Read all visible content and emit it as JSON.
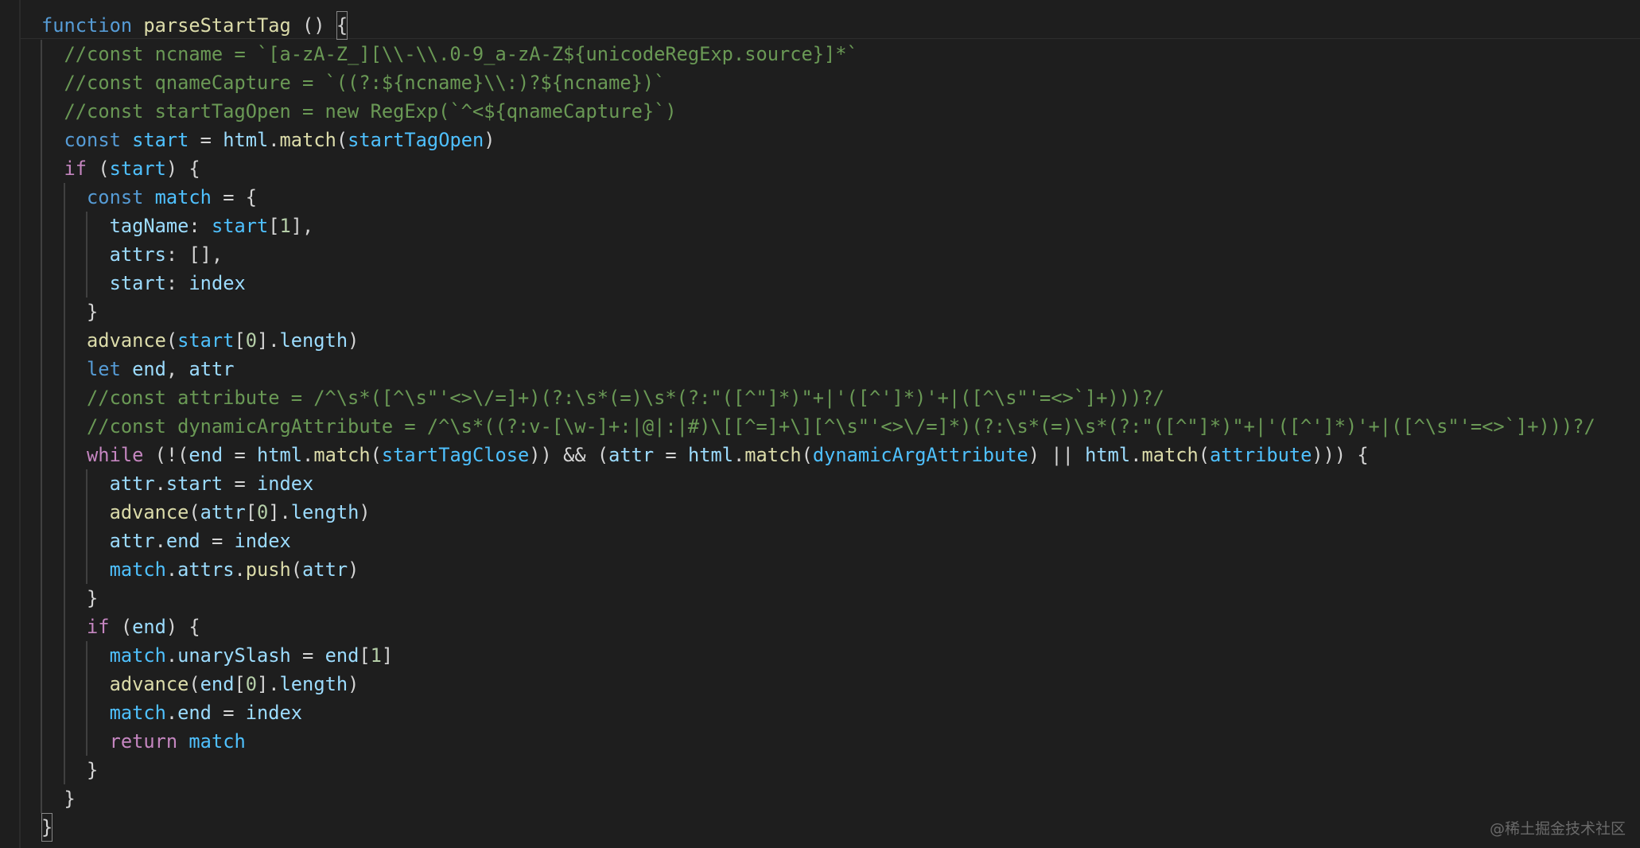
{
  "code": {
    "lines": [
      {
        "tokens": [
          {
            "c": "kw",
            "t": "function"
          },
          {
            "c": "pl",
            "t": " "
          },
          {
            "c": "fn",
            "t": "parseStartTag"
          },
          {
            "c": "pl",
            "t": " () "
          },
          {
            "c": "pl",
            "t": "{"
          }
        ]
      },
      {
        "tokens": [
          {
            "c": "pl",
            "t": "  "
          },
          {
            "c": "cm",
            "t": "//const ncname = `[a-zA-Z_][\\\\-\\\\.0-9_a-zA-Z${unicodeRegExp.source}]*`"
          }
        ]
      },
      {
        "tokens": [
          {
            "c": "pl",
            "t": "  "
          },
          {
            "c": "cm",
            "t": "//const qnameCapture = `((?:${ncname}\\\\:)?${ncname})`"
          }
        ]
      },
      {
        "tokens": [
          {
            "c": "pl",
            "t": "  "
          },
          {
            "c": "cm",
            "t": "//const startTagOpen = new RegExp(`^<${qnameCapture}`)"
          }
        ]
      },
      {
        "tokens": [
          {
            "c": "pl",
            "t": "  "
          },
          {
            "c": "kw",
            "t": "const"
          },
          {
            "c": "pl",
            "t": " "
          },
          {
            "c": "cst",
            "t": "start"
          },
          {
            "c": "pl",
            "t": " = "
          },
          {
            "c": "var",
            "t": "html"
          },
          {
            "c": "pl",
            "t": "."
          },
          {
            "c": "fn",
            "t": "match"
          },
          {
            "c": "pl",
            "t": "("
          },
          {
            "c": "cst",
            "t": "startTagOpen"
          },
          {
            "c": "pl",
            "t": ")"
          }
        ]
      },
      {
        "tokens": [
          {
            "c": "pl",
            "t": "  "
          },
          {
            "c": "ctl",
            "t": "if"
          },
          {
            "c": "pl",
            "t": " ("
          },
          {
            "c": "cst",
            "t": "start"
          },
          {
            "c": "pl",
            "t": ") {"
          }
        ]
      },
      {
        "tokens": [
          {
            "c": "pl",
            "t": "    "
          },
          {
            "c": "kw",
            "t": "const"
          },
          {
            "c": "pl",
            "t": " "
          },
          {
            "c": "cst",
            "t": "match"
          },
          {
            "c": "pl",
            "t": " = {"
          }
        ]
      },
      {
        "tokens": [
          {
            "c": "pl",
            "t": "      "
          },
          {
            "c": "var",
            "t": "tagName"
          },
          {
            "c": "pl",
            "t": ": "
          },
          {
            "c": "cst",
            "t": "start"
          },
          {
            "c": "pl",
            "t": "["
          },
          {
            "c": "num",
            "t": "1"
          },
          {
            "c": "pl",
            "t": "],"
          }
        ]
      },
      {
        "tokens": [
          {
            "c": "pl",
            "t": "      "
          },
          {
            "c": "var",
            "t": "attrs"
          },
          {
            "c": "pl",
            "t": ": [],"
          }
        ]
      },
      {
        "tokens": [
          {
            "c": "pl",
            "t": "      "
          },
          {
            "c": "var",
            "t": "start"
          },
          {
            "c": "pl",
            "t": ": "
          },
          {
            "c": "var",
            "t": "index"
          }
        ]
      },
      {
        "tokens": [
          {
            "c": "pl",
            "t": "    }"
          }
        ]
      },
      {
        "tokens": [
          {
            "c": "pl",
            "t": "    "
          },
          {
            "c": "fn",
            "t": "advance"
          },
          {
            "c": "pl",
            "t": "("
          },
          {
            "c": "cst",
            "t": "start"
          },
          {
            "c": "pl",
            "t": "["
          },
          {
            "c": "num",
            "t": "0"
          },
          {
            "c": "pl",
            "t": "]."
          },
          {
            "c": "var",
            "t": "length"
          },
          {
            "c": "pl",
            "t": ")"
          }
        ]
      },
      {
        "tokens": [
          {
            "c": "pl",
            "t": "    "
          },
          {
            "c": "kw",
            "t": "let"
          },
          {
            "c": "pl",
            "t": " "
          },
          {
            "c": "var",
            "t": "end"
          },
          {
            "c": "pl",
            "t": ", "
          },
          {
            "c": "var",
            "t": "attr"
          }
        ]
      },
      {
        "tokens": [
          {
            "c": "pl",
            "t": "    "
          },
          {
            "c": "cm",
            "t": "//const attribute = /^\\s*([^\\s\"'<>\\/=]+)(?:\\s*(=)\\s*(?:\"([^\"]*)\"+|'([^']*)'+|([^\\s\"'=<>`]+)))?/"
          }
        ]
      },
      {
        "tokens": [
          {
            "c": "pl",
            "t": "    "
          },
          {
            "c": "cm",
            "t": "//const dynamicArgAttribute = /^\\s*((?:v-[\\w-]+:|@|:|#)\\[[^=]+\\][^\\s\"'<>\\/=]*)(?:\\s*(=)\\s*(?:\"([^\"]*)\"+|'([^']*)'+|([^\\s\"'=<>`]+)))?/"
          }
        ]
      },
      {
        "tokens": [
          {
            "c": "pl",
            "t": "    "
          },
          {
            "c": "ctl",
            "t": "while"
          },
          {
            "c": "pl",
            "t": " (!("
          },
          {
            "c": "var",
            "t": "end"
          },
          {
            "c": "pl",
            "t": " = "
          },
          {
            "c": "var",
            "t": "html"
          },
          {
            "c": "pl",
            "t": "."
          },
          {
            "c": "fn",
            "t": "match"
          },
          {
            "c": "pl",
            "t": "("
          },
          {
            "c": "cst",
            "t": "startTagClose"
          },
          {
            "c": "pl",
            "t": ")) && ("
          },
          {
            "c": "var",
            "t": "attr"
          },
          {
            "c": "pl",
            "t": " = "
          },
          {
            "c": "var",
            "t": "html"
          },
          {
            "c": "pl",
            "t": "."
          },
          {
            "c": "fn",
            "t": "match"
          },
          {
            "c": "pl",
            "t": "("
          },
          {
            "c": "cst",
            "t": "dynamicArgAttribute"
          },
          {
            "c": "pl",
            "t": ") || "
          },
          {
            "c": "var",
            "t": "html"
          },
          {
            "c": "pl",
            "t": "."
          },
          {
            "c": "fn",
            "t": "match"
          },
          {
            "c": "pl",
            "t": "("
          },
          {
            "c": "cst",
            "t": "attribute"
          },
          {
            "c": "pl",
            "t": "))) {"
          }
        ]
      },
      {
        "tokens": [
          {
            "c": "pl",
            "t": "      "
          },
          {
            "c": "var",
            "t": "attr"
          },
          {
            "c": "pl",
            "t": "."
          },
          {
            "c": "var",
            "t": "start"
          },
          {
            "c": "pl",
            "t": " = "
          },
          {
            "c": "var",
            "t": "index"
          }
        ]
      },
      {
        "tokens": [
          {
            "c": "pl",
            "t": "      "
          },
          {
            "c": "fn",
            "t": "advance"
          },
          {
            "c": "pl",
            "t": "("
          },
          {
            "c": "var",
            "t": "attr"
          },
          {
            "c": "pl",
            "t": "["
          },
          {
            "c": "num",
            "t": "0"
          },
          {
            "c": "pl",
            "t": "]."
          },
          {
            "c": "var",
            "t": "length"
          },
          {
            "c": "pl",
            "t": ")"
          }
        ]
      },
      {
        "tokens": [
          {
            "c": "pl",
            "t": "      "
          },
          {
            "c": "var",
            "t": "attr"
          },
          {
            "c": "pl",
            "t": "."
          },
          {
            "c": "var",
            "t": "end"
          },
          {
            "c": "pl",
            "t": " = "
          },
          {
            "c": "var",
            "t": "index"
          }
        ]
      },
      {
        "tokens": [
          {
            "c": "pl",
            "t": "      "
          },
          {
            "c": "cst",
            "t": "match"
          },
          {
            "c": "pl",
            "t": "."
          },
          {
            "c": "var",
            "t": "attrs"
          },
          {
            "c": "pl",
            "t": "."
          },
          {
            "c": "fn",
            "t": "push"
          },
          {
            "c": "pl",
            "t": "("
          },
          {
            "c": "var",
            "t": "attr"
          },
          {
            "c": "pl",
            "t": ")"
          }
        ]
      },
      {
        "tokens": [
          {
            "c": "pl",
            "t": "    }"
          }
        ]
      },
      {
        "tokens": [
          {
            "c": "pl",
            "t": "    "
          },
          {
            "c": "ctl",
            "t": "if"
          },
          {
            "c": "pl",
            "t": " ("
          },
          {
            "c": "var",
            "t": "end"
          },
          {
            "c": "pl",
            "t": ") {"
          }
        ]
      },
      {
        "tokens": [
          {
            "c": "pl",
            "t": "      "
          },
          {
            "c": "cst",
            "t": "match"
          },
          {
            "c": "pl",
            "t": "."
          },
          {
            "c": "var",
            "t": "unarySlash"
          },
          {
            "c": "pl",
            "t": " = "
          },
          {
            "c": "var",
            "t": "end"
          },
          {
            "c": "pl",
            "t": "["
          },
          {
            "c": "num",
            "t": "1"
          },
          {
            "c": "pl",
            "t": "]"
          }
        ]
      },
      {
        "tokens": [
          {
            "c": "pl",
            "t": "      "
          },
          {
            "c": "fn",
            "t": "advance"
          },
          {
            "c": "pl",
            "t": "("
          },
          {
            "c": "var",
            "t": "end"
          },
          {
            "c": "pl",
            "t": "["
          },
          {
            "c": "num",
            "t": "0"
          },
          {
            "c": "pl",
            "t": "]."
          },
          {
            "c": "var",
            "t": "length"
          },
          {
            "c": "pl",
            "t": ")"
          }
        ]
      },
      {
        "tokens": [
          {
            "c": "pl",
            "t": "      "
          },
          {
            "c": "cst",
            "t": "match"
          },
          {
            "c": "pl",
            "t": "."
          },
          {
            "c": "var",
            "t": "end"
          },
          {
            "c": "pl",
            "t": " = "
          },
          {
            "c": "var",
            "t": "index"
          }
        ]
      },
      {
        "tokens": [
          {
            "c": "pl",
            "t": "      "
          },
          {
            "c": "ctl",
            "t": "return"
          },
          {
            "c": "pl",
            "t": " "
          },
          {
            "c": "cst",
            "t": "match"
          }
        ]
      },
      {
        "tokens": [
          {
            "c": "pl",
            "t": "    }"
          }
        ]
      },
      {
        "tokens": [
          {
            "c": "pl",
            "t": "  }"
          }
        ]
      },
      {
        "tokens": [
          {
            "c": "pl",
            "t": "}"
          }
        ]
      }
    ]
  },
  "watermark": "@稀土掘金技术社区"
}
